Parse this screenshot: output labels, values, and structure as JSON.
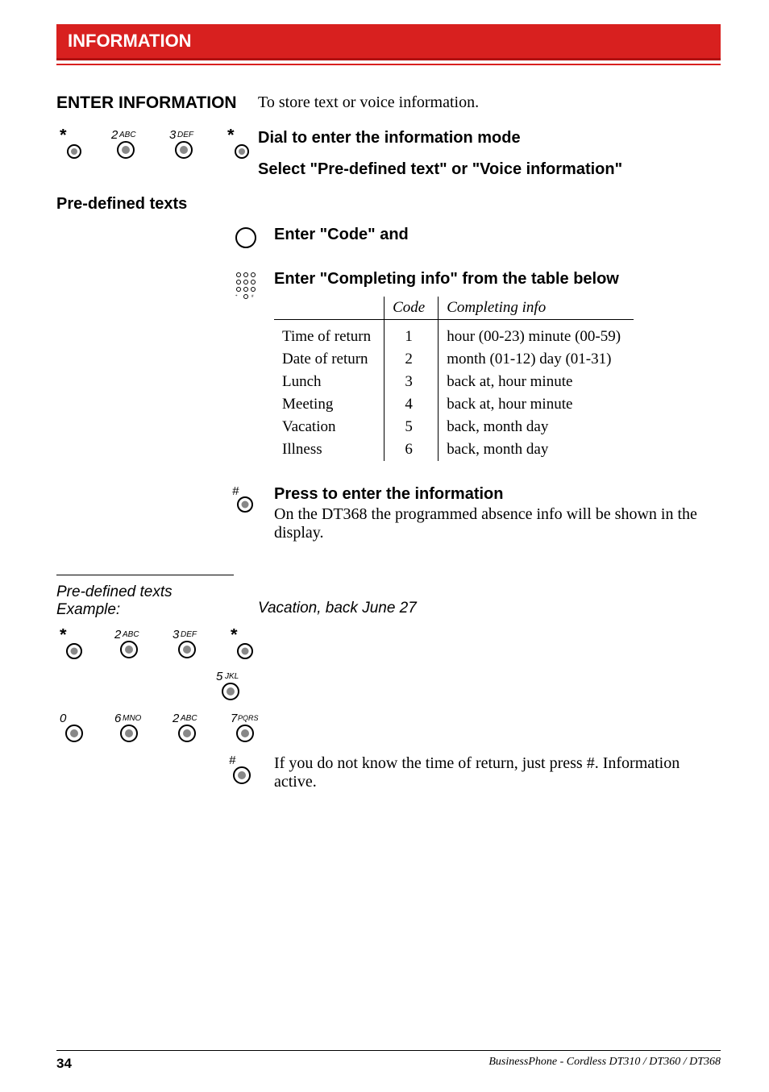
{
  "header": {
    "title": "INFORMATION"
  },
  "enter_info": {
    "heading": "ENTER INFORMATION",
    "desc": "To store text or voice information.",
    "dial_instr": "Dial to enter the information mode",
    "select_instr": "Select \"Pre-defined text\" or \"Voice information\""
  },
  "predefined": {
    "heading": "Pre-defined texts",
    "enter_code": "Enter \"Code\" and",
    "enter_completing": "Enter \"Completing info\" from the table below"
  },
  "table": {
    "head": {
      "c1": "",
      "c2": "Code",
      "c3": "Completing info"
    },
    "rows": [
      {
        "name": "Time of return",
        "code": "1",
        "info": "hour (00-23) minute (00-59)"
      },
      {
        "name": "Date of return",
        "code": "2",
        "info": "month (01-12) day (01-31)"
      },
      {
        "name": "Lunch",
        "code": "3",
        "info": "back at, hour minute"
      },
      {
        "name": "Meeting",
        "code": "4",
        "info": "back at, hour minute"
      },
      {
        "name": "Vacation",
        "code": "5",
        "info": "back, month day"
      },
      {
        "name": "Illness",
        "code": "6",
        "info": "back, month day"
      }
    ]
  },
  "press": {
    "heading": "Press to enter the information",
    "body": "On the DT368 the programmed absence info will be shown in the display."
  },
  "example": {
    "heading1": "Pre-defined texts",
    "heading2": "Example:",
    "right": "Vacation, back June 27",
    "footer_text": "If you do not know the time of return, just press #. Information active."
  },
  "footer": {
    "page_no": "34",
    "text": "BusinessPhone - Cordless DT310 / DT360 / DT368"
  },
  "icons": {
    "star": "*",
    "two": "2",
    "twosup": "ABC",
    "three": "3",
    "threesup": "DEF",
    "five": "5",
    "fivesup": "JKL",
    "zero": "0",
    "six": "6",
    "sixsup": "MNO",
    "seven": "7",
    "sevensup": "PQRS",
    "hash": "#"
  }
}
